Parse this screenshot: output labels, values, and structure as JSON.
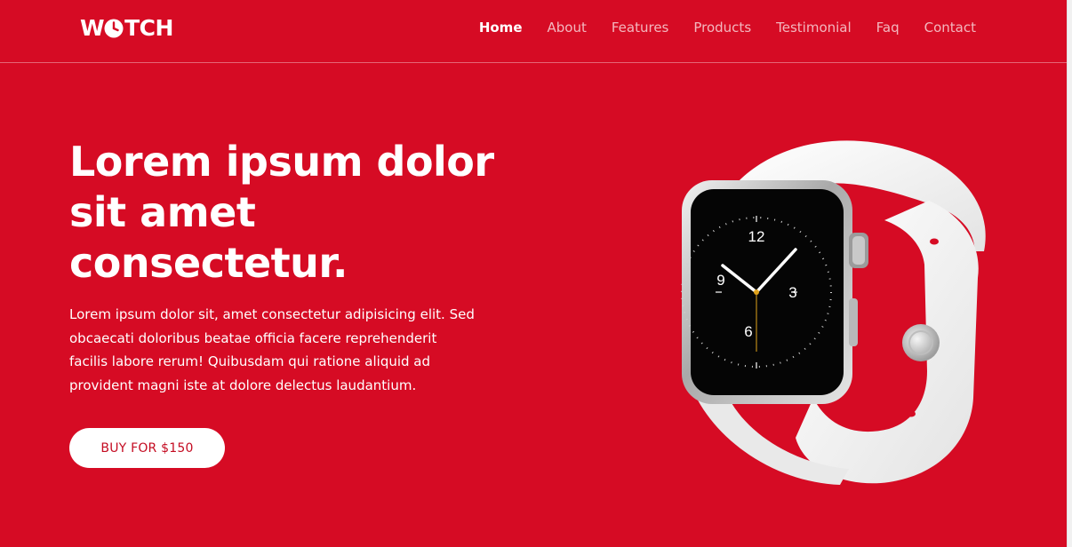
{
  "brand": {
    "logo_prefix": "W",
    "logo_suffix": "TCH"
  },
  "nav": {
    "items": [
      {
        "label": "Home",
        "active": true
      },
      {
        "label": "About",
        "active": false
      },
      {
        "label": "Features",
        "active": false
      },
      {
        "label": "Products",
        "active": false
      },
      {
        "label": "Testimonial",
        "active": false
      },
      {
        "label": "Faq",
        "active": false
      },
      {
        "label": "Contact",
        "active": false
      }
    ]
  },
  "hero": {
    "title_lines": [
      "Lorem ipsum dolor",
      "sit amet",
      "consectetur."
    ],
    "description_lines": [
      "Lorem ipsum dolor sit, amet consectetur adipisicing elit. Sed",
      "obcaecati doloribus beatae officia facere reprehenderit",
      "facilis labore rerum! Quibusdam qui ratione aliquid ad",
      "provident magni iste at dolore delectus laudantium."
    ],
    "buy_label": "BUY FOR $150"
  },
  "watch": {
    "dial_numbers": [
      "12",
      "3",
      "6",
      "9"
    ]
  },
  "colors": {
    "background": "#d60b24",
    "button_text": "#c40b21",
    "text": "#ffffff"
  }
}
